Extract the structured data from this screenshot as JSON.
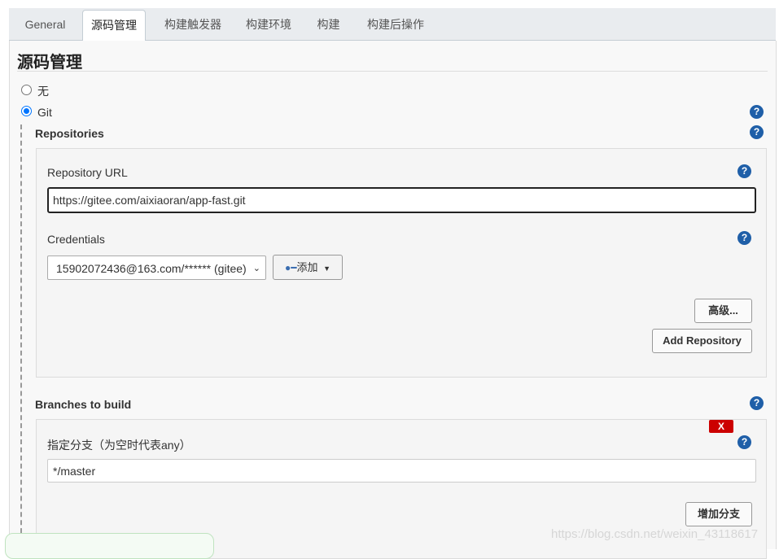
{
  "tabs": [
    {
      "label": "General",
      "active": false
    },
    {
      "label": "源码管理",
      "active": true
    },
    {
      "label": "构建触发器",
      "active": false
    },
    {
      "label": "构建环境",
      "active": false
    },
    {
      "label": "构建",
      "active": false
    },
    {
      "label": "构建后操作",
      "active": false
    }
  ],
  "section": {
    "title": "源码管理"
  },
  "scm": {
    "none_label": "无",
    "git_label": "Git",
    "selected": "Git"
  },
  "repositories": {
    "label": "Repositories",
    "url_label": "Repository URL",
    "url_value": "https://gitee.com/aixiaoran/app-fast.git",
    "credentials_label": "Credentials",
    "credentials_value": "15902072436@163.com/****** (gitee)",
    "add_label": "添加",
    "advanced_label": "高级...",
    "add_repository_label": "Add Repository"
  },
  "branches": {
    "label": "Branches to build",
    "delete_label": "X",
    "spec_label": "指定分支（为空时代表any）",
    "spec_value": "*/master",
    "add_branch_label": "增加分支"
  },
  "help_icon_glyph": "?",
  "watermark": "https://blog.csdn.net/weixin_43118617",
  "colors": {
    "help": "#1f5fa8",
    "delete": "#cc0000",
    "radio": "#0075ff"
  }
}
